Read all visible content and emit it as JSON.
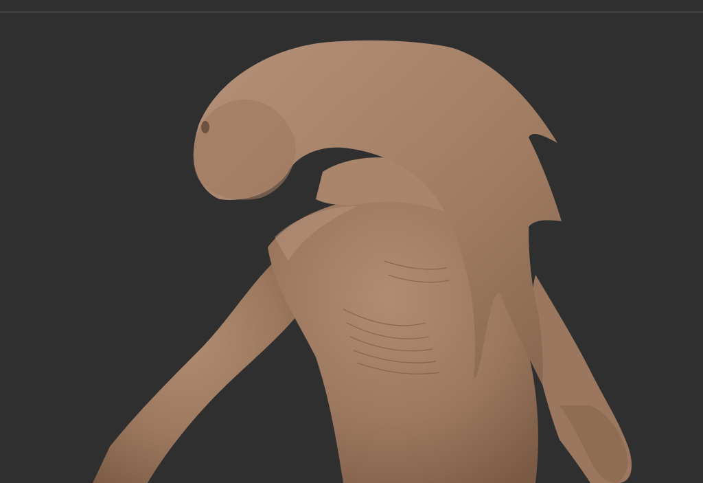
{
  "viewport": {
    "background_color": "#2f2f30",
    "divider_color": "#6b6b6b"
  },
  "model": {
    "material_color": "#a07c62",
    "highlight_color": "#b8957a",
    "shadow_color": "#7a5a45"
  }
}
